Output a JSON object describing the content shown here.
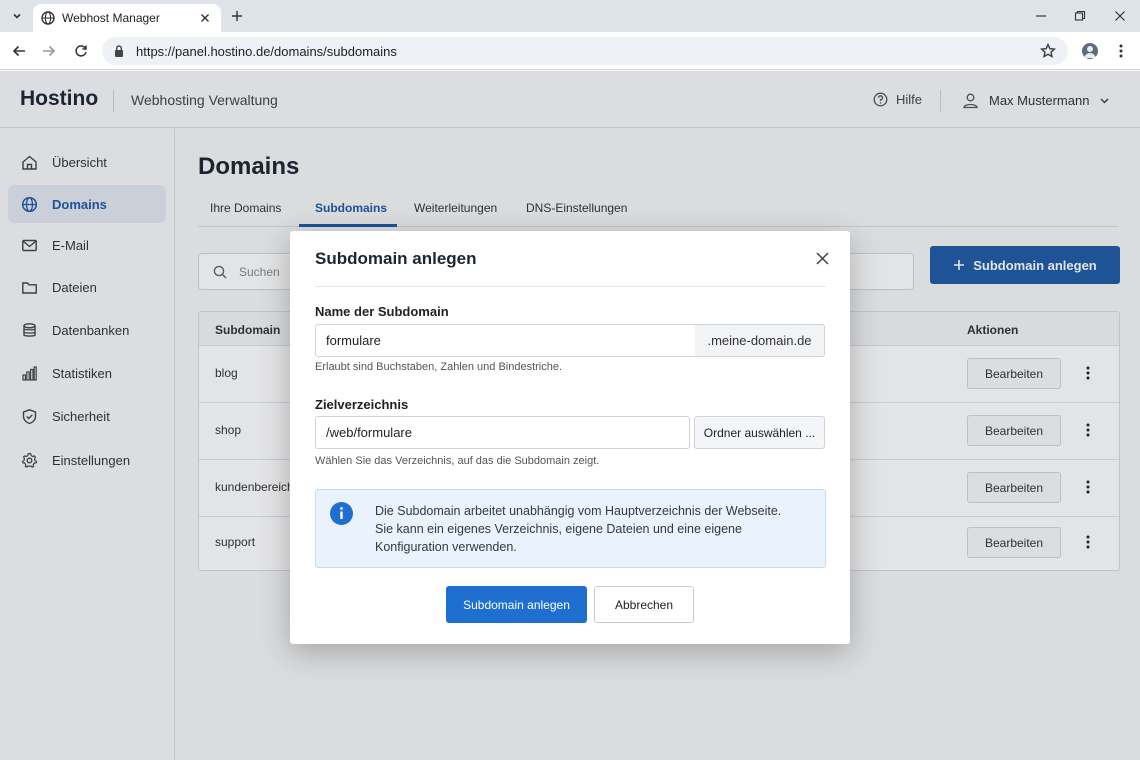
{
  "browser": {
    "tab_title": "Webhost Manager",
    "url": "https://panel.hostino.de/domains/subdomains"
  },
  "header": {
    "brand": "Hostino",
    "subtitle": "Webhosting Verwaltung",
    "help": "Hilfe",
    "user": "Max Mustermann"
  },
  "sidebar": {
    "items": [
      {
        "label": "Übersicht",
        "icon": "home-icon"
      },
      {
        "label": "Domains",
        "icon": "globe-icon",
        "active": true
      },
      {
        "label": "E-Mail",
        "icon": "mail-icon"
      },
      {
        "label": "Dateien",
        "icon": "folder-icon"
      },
      {
        "label": "Datenbanken",
        "icon": "database-icon"
      },
      {
        "label": "Statistiken",
        "icon": "stats-icon"
      },
      {
        "label": "Sicherheit",
        "icon": "shield-icon"
      },
      {
        "label": "Einstellungen",
        "icon": "gear-icon"
      }
    ]
  },
  "main": {
    "title": "Domains",
    "tabs": [
      "Ihre Domains",
      "Subdomains",
      "Weiterleitungen",
      "DNS-Einstellungen"
    ],
    "active_tab": "Subdomains",
    "search_placeholder": "Suchen",
    "add_button": "Subdomain anlegen",
    "table": {
      "columns": [
        "Subdomain",
        "Aktionen"
      ],
      "rows": [
        {
          "name": "blog",
          "action": "Bearbeiten"
        },
        {
          "name": "shop",
          "action": "Bearbeiten"
        },
        {
          "name": "kundenbereich",
          "action": "Bearbeiten"
        },
        {
          "name": "support",
          "action": "Bearbeiten"
        }
      ]
    }
  },
  "dialog": {
    "title": "Subdomain anlegen",
    "name_label": "Name der Subdomain",
    "name_value": "formulare",
    "domain_suffix": ".meine-domain.de",
    "name_hint": "Erlaubt sind Buchstaben, Zahlen und Bindestriche.",
    "dir_label": "Zielverzeichnis",
    "dir_value": "/web/formulare",
    "browse_button": "Ordner auswählen ...",
    "dir_hint": "Wählen Sie das Verzeichnis, auf das die Subdomain zeigt.",
    "info_line1": "Die Subdomain arbeitet unabhängig vom Hauptverzeichnis der Webseite.",
    "info_line2": "Sie kann ein eigenes Verzeichnis, eigene Dateien und eine eigene Konfiguration verwenden.",
    "primary_button": "Subdomain anlegen",
    "cancel_button": "Abbrechen"
  },
  "colors": {
    "accent": "#1f5ba6",
    "primary_button": "#1f6fd1",
    "info_bg": "#eaf2fb"
  }
}
